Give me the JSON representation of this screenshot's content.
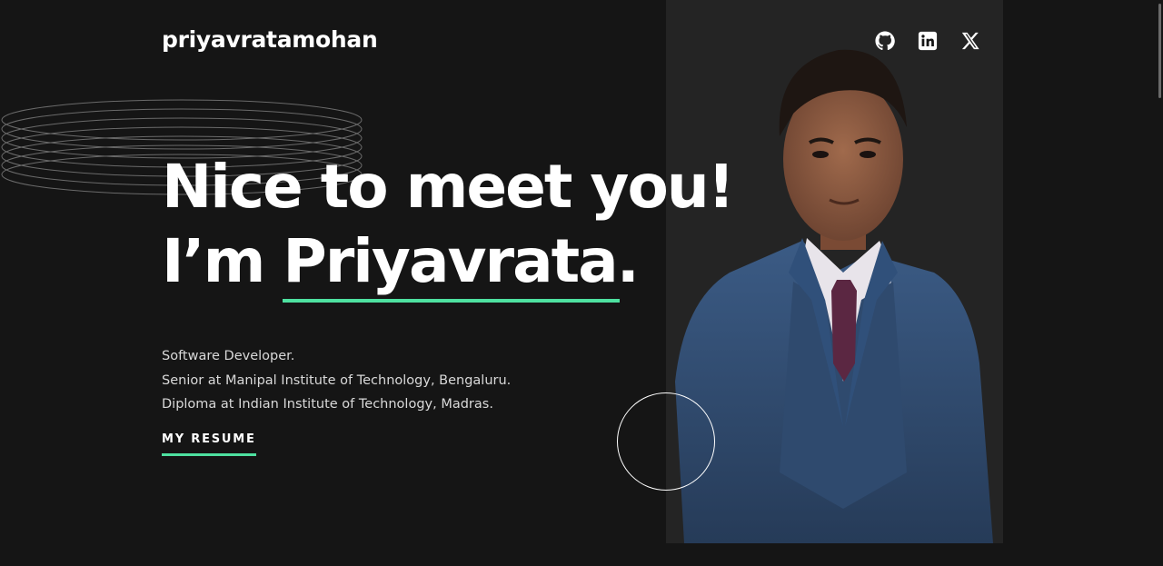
{
  "header": {
    "logo": "priyavratamohan",
    "socials": [
      {
        "icon": "github-icon"
      },
      {
        "icon": "linkedin-icon"
      },
      {
        "icon": "x-icon"
      }
    ]
  },
  "hero": {
    "line1": "Nice to meet you!",
    "line2_prefix": "I’m ",
    "name": "Priyavrata."
  },
  "bio": [
    "Software Developer.",
    "Senior at Manipal Institute of Technology, Bengaluru.",
    "Diploma at Indian Institute of Technology, Madras."
  ],
  "cta": {
    "resume_label": "MY RESUME"
  },
  "colors": {
    "background": "#151515",
    "photo_panel": "#242424",
    "accent": "#4ee1a0",
    "text": "#ffffff",
    "body_text": "#d9d9d9"
  }
}
